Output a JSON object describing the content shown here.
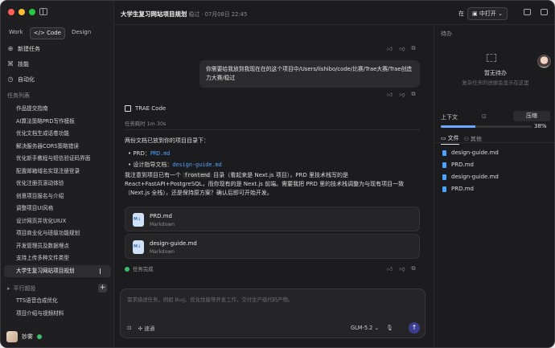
{
  "sidebar": {
    "modes": [
      "Work",
      "Code",
      "Design"
    ],
    "active_mode": "Code",
    "nav": [
      {
        "label": "新建任务",
        "icon": "new-task-icon"
      },
      {
        "label": "技能",
        "icon": "skills-icon"
      },
      {
        "label": "自动化",
        "icon": "automation-icon"
      }
    ],
    "task_section_title": "任务列表",
    "tasks": [
      "作品提交指南",
      "AI算法策略PRD写作模板",
      "优化文档生成话卷功能",
      "解决服务器CORS策略错误",
      "优化新手教程与短信验证码界面",
      "配置邮箱域名实现注册登录",
      "优化注册页滚动体验",
      "创意项目报名与介绍",
      "调整项目UI风格",
      "设计网页并优化UIUX",
      "项目商业化与班级功能规划",
      "开发管理员及数据埋点",
      "支持上传多种文件类型",
      "大学生复习网站项目规划"
    ],
    "active_task": "大学生复习网站项目规划",
    "parallel_title": "平行超投",
    "parallel_tasks": [
      "TTS语音合成优化",
      "项目介绍与视频材料"
    ],
    "user_name": "妙雾"
  },
  "topbar": {
    "title": "大学生复习网站项目规划",
    "subtitle": "稳过 · 07月08日 22:45",
    "open_in_prefix": "在",
    "open_in_label": "中打开"
  },
  "chat": {
    "user_message": "你需要给我放到我现在在的这个项目中/Users/lishibo/code/比赛/Trae大赛/Trae创造力大赛/稳过",
    "agent_name": "TRAE Code",
    "duration": "任务耗时 1m 30s",
    "intro": "两份文档已放到你的项目目录下：",
    "bullets": [
      {
        "label": "PRD：",
        "file": "PRD.md"
      },
      {
        "label": "设计指导文档：",
        "file": "design-guide.md"
      }
    ],
    "para_before_code": "我注意到项目已有一个",
    "inline_code": "frontend",
    "para_after_code": "目录（看起来是 Next.js 项目），PRD 里技术栈写的是 React+FastAPI+PostgreSQL，而你现有的是 Next.js 前端。需要我把 PRD 里的技术栈调整为与现有项目一致（Next.js 全栈），还是保持原方案？确认后即可开始开发。",
    "files": [
      {
        "name": "PRD.md",
        "type": "Markdown"
      },
      {
        "name": "design-guide.md",
        "type": "Markdown"
      }
    ],
    "done_label": "任务完成"
  },
  "composer": {
    "placeholder": "需求描述任务，例如 Bug、优化性能等开发工作，交付生产级代码产物。",
    "mode_label": "速通",
    "model": "GLM-5.2"
  },
  "right_panel": {
    "todo_title": "待办",
    "todo_empty_title": "暂无待办",
    "todo_empty_desc": "复杂任务的进展会显示在这里",
    "context_label": "上下文",
    "compress_label": "压缩",
    "context_percent": "38%",
    "context_fraction": 0.38,
    "tabs": [
      "文件",
      "其他"
    ],
    "active_tab": "文件",
    "files": [
      "design-guide.md",
      "PRD.md",
      "design-guide.md",
      "PRD.md"
    ]
  },
  "colors": {
    "accent": "#4aa3ff",
    "success": "#3bbf6f",
    "background": "#1c1c1e"
  }
}
